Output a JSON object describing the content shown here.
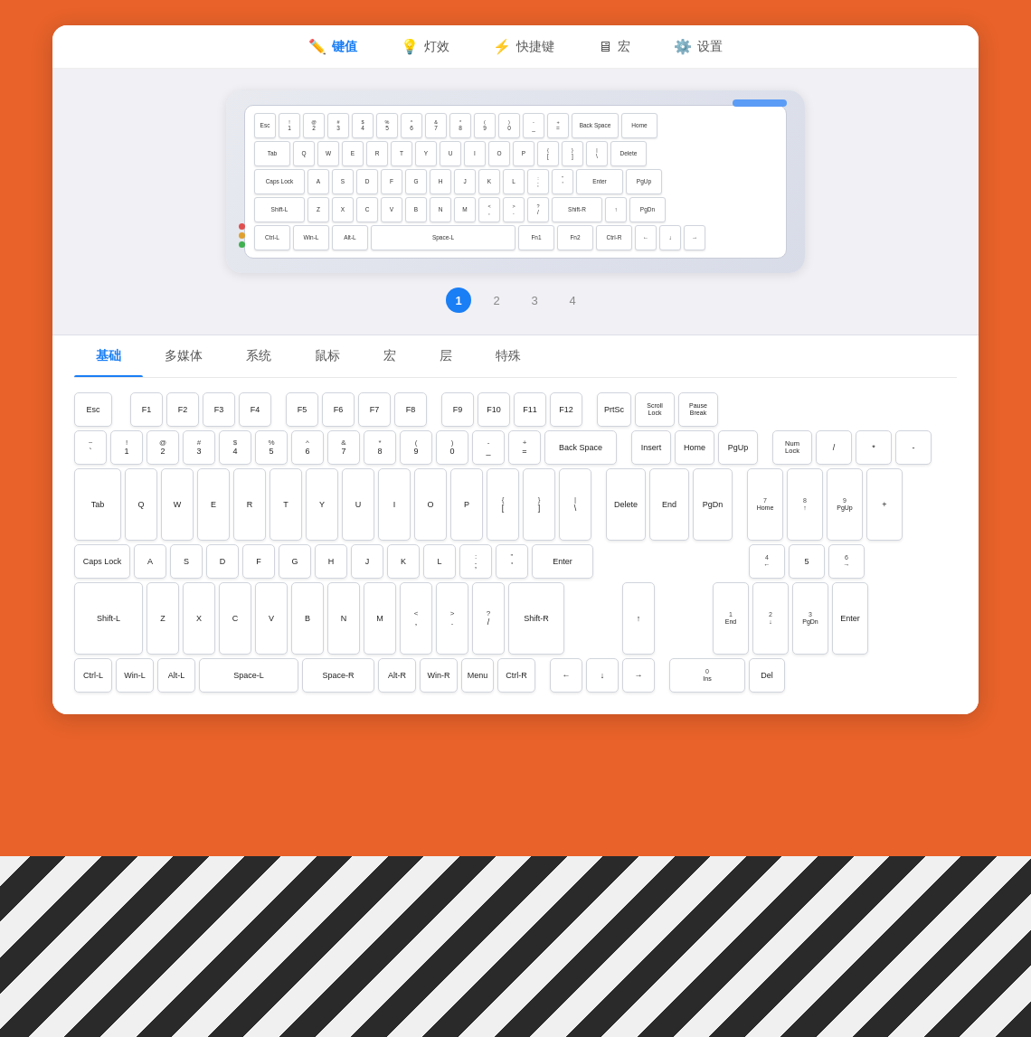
{
  "nav": {
    "items": [
      {
        "label": "键值",
        "icon": "✏️",
        "active": true
      },
      {
        "label": "灯效",
        "icon": "💡",
        "active": false
      },
      {
        "label": "快捷键",
        "icon": "⚡",
        "active": false
      },
      {
        "label": "宏",
        "icon": "🖥",
        "active": false
      },
      {
        "label": "设置",
        "icon": "⚙️",
        "active": false
      }
    ]
  },
  "pages": [
    "1",
    "2",
    "3",
    "4"
  ],
  "categories": [
    "基础",
    "多媒体",
    "系统",
    "鼠标",
    "宏",
    "层",
    "特殊"
  ],
  "activeCat": "基础",
  "miniKeyboard": {
    "rows": [
      [
        "Esc",
        "!1",
        "@2",
        "#3",
        "$4",
        "%5",
        "^6",
        "&7",
        "*8",
        "(9",
        ")0",
        "-_",
        "+=",
        "Back Space",
        "Home"
      ],
      [
        "Tab",
        "Q",
        "W",
        "E",
        "R",
        "T",
        "Y",
        "U",
        "I",
        "O",
        "P",
        "{[",
        "}]",
        "|\\ ",
        "Delete"
      ],
      [
        "Caps Lock",
        "A",
        "S",
        "D",
        "F",
        "G",
        "H",
        "J",
        "K",
        "L",
        ";:",
        "'\"",
        "Enter",
        "PgUp"
      ],
      [
        "Shift-L",
        "Z",
        "X",
        "C",
        "V",
        "B",
        "N",
        "M",
        "<,",
        ">.",
        "?/",
        "Shift-R",
        "↑",
        "PgDn"
      ],
      [
        "Ctrl-L",
        "Win-L",
        "Alt-L",
        "Space-L",
        "Fn1",
        "Fn2",
        "Ctrl-R",
        "←",
        "↓",
        "→"
      ]
    ]
  },
  "fullKeyboard": {
    "row1": [
      "Esc",
      "F1",
      "F2",
      "F3",
      "F4",
      "F5",
      "F6",
      "F7",
      "F8",
      "F9",
      "F10",
      "F11",
      "F12",
      "PrtSc",
      "Scroll Lock",
      "Pause Break"
    ],
    "row2_main": [
      "-~",
      "!1",
      "@2",
      "#3",
      "$4",
      "%5",
      "^6",
      "&7",
      "*8",
      "(9",
      ")0",
      "-_",
      "+=",
      "Back Space"
    ],
    "row2_nav": [
      "Insert",
      "Home",
      "PgUp"
    ],
    "row2_num": [
      "Num Lock",
      "/",
      "*",
      "-"
    ],
    "row3_main": [
      "Tab",
      "Q",
      "W",
      "E",
      "R",
      "T",
      "Y",
      "U",
      "I",
      "O",
      "P",
      "{[",
      "}]",
      "|\\ "
    ],
    "row3_nav": [
      "Delete",
      "End",
      "PgDn"
    ],
    "row3_num": [
      "7 Home",
      "8 ↑",
      "9 PgUp",
      "+"
    ],
    "row4_main": [
      "Caps Lock",
      "A",
      "S",
      "D",
      "F",
      "G",
      "H",
      "J",
      "K",
      "L",
      ";:",
      "'\"",
      "Enter"
    ],
    "row4_num": [
      "4 ←",
      "5",
      "6 →"
    ],
    "row5_main": [
      "Shift-L",
      "Z",
      "X",
      "C",
      "V",
      "B",
      "N",
      "M",
      "<,",
      ">.",
      "?/",
      "Shift-R"
    ],
    "row5_mid": [
      "↑"
    ],
    "row5_num": [
      "1 End",
      "2 ↓",
      "3 PgDn",
      "Enter"
    ],
    "row6_main": [
      "Ctrl-L",
      "Win-L",
      "Alt-L",
      "Space-L",
      "Space-R",
      "Alt-R",
      "Win-R",
      "Menu",
      "Ctrl-R"
    ],
    "row6_arr": [
      "←",
      "↓",
      "→"
    ],
    "row6_num": [
      "0 Ins",
      "Del"
    ]
  }
}
